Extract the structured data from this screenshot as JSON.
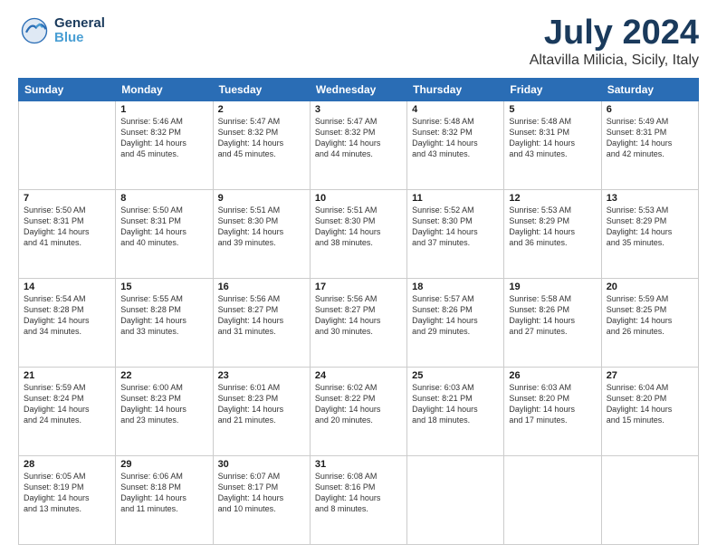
{
  "header": {
    "logo_general": "General",
    "logo_blue": "Blue",
    "month_title": "July 2024",
    "location": "Altavilla Milicia, Sicily, Italy"
  },
  "calendar": {
    "days_of_week": [
      "Sunday",
      "Monday",
      "Tuesday",
      "Wednesday",
      "Thursday",
      "Friday",
      "Saturday"
    ],
    "weeks": [
      [
        {
          "day": "",
          "info": ""
        },
        {
          "day": "1",
          "info": "Sunrise: 5:46 AM\nSunset: 8:32 PM\nDaylight: 14 hours\nand 45 minutes."
        },
        {
          "day": "2",
          "info": "Sunrise: 5:47 AM\nSunset: 8:32 PM\nDaylight: 14 hours\nand 45 minutes."
        },
        {
          "day": "3",
          "info": "Sunrise: 5:47 AM\nSunset: 8:32 PM\nDaylight: 14 hours\nand 44 minutes."
        },
        {
          "day": "4",
          "info": "Sunrise: 5:48 AM\nSunset: 8:32 PM\nDaylight: 14 hours\nand 43 minutes."
        },
        {
          "day": "5",
          "info": "Sunrise: 5:48 AM\nSunset: 8:31 PM\nDaylight: 14 hours\nand 43 minutes."
        },
        {
          "day": "6",
          "info": "Sunrise: 5:49 AM\nSunset: 8:31 PM\nDaylight: 14 hours\nand 42 minutes."
        }
      ],
      [
        {
          "day": "7",
          "info": "Sunrise: 5:50 AM\nSunset: 8:31 PM\nDaylight: 14 hours\nand 41 minutes."
        },
        {
          "day": "8",
          "info": "Sunrise: 5:50 AM\nSunset: 8:31 PM\nDaylight: 14 hours\nand 40 minutes."
        },
        {
          "day": "9",
          "info": "Sunrise: 5:51 AM\nSunset: 8:30 PM\nDaylight: 14 hours\nand 39 minutes."
        },
        {
          "day": "10",
          "info": "Sunrise: 5:51 AM\nSunset: 8:30 PM\nDaylight: 14 hours\nand 38 minutes."
        },
        {
          "day": "11",
          "info": "Sunrise: 5:52 AM\nSunset: 8:30 PM\nDaylight: 14 hours\nand 37 minutes."
        },
        {
          "day": "12",
          "info": "Sunrise: 5:53 AM\nSunset: 8:29 PM\nDaylight: 14 hours\nand 36 minutes."
        },
        {
          "day": "13",
          "info": "Sunrise: 5:53 AM\nSunset: 8:29 PM\nDaylight: 14 hours\nand 35 minutes."
        }
      ],
      [
        {
          "day": "14",
          "info": "Sunrise: 5:54 AM\nSunset: 8:28 PM\nDaylight: 14 hours\nand 34 minutes."
        },
        {
          "day": "15",
          "info": "Sunrise: 5:55 AM\nSunset: 8:28 PM\nDaylight: 14 hours\nand 33 minutes."
        },
        {
          "day": "16",
          "info": "Sunrise: 5:56 AM\nSunset: 8:27 PM\nDaylight: 14 hours\nand 31 minutes."
        },
        {
          "day": "17",
          "info": "Sunrise: 5:56 AM\nSunset: 8:27 PM\nDaylight: 14 hours\nand 30 minutes."
        },
        {
          "day": "18",
          "info": "Sunrise: 5:57 AM\nSunset: 8:26 PM\nDaylight: 14 hours\nand 29 minutes."
        },
        {
          "day": "19",
          "info": "Sunrise: 5:58 AM\nSunset: 8:26 PM\nDaylight: 14 hours\nand 27 minutes."
        },
        {
          "day": "20",
          "info": "Sunrise: 5:59 AM\nSunset: 8:25 PM\nDaylight: 14 hours\nand 26 minutes."
        }
      ],
      [
        {
          "day": "21",
          "info": "Sunrise: 5:59 AM\nSunset: 8:24 PM\nDaylight: 14 hours\nand 24 minutes."
        },
        {
          "day": "22",
          "info": "Sunrise: 6:00 AM\nSunset: 8:23 PM\nDaylight: 14 hours\nand 23 minutes."
        },
        {
          "day": "23",
          "info": "Sunrise: 6:01 AM\nSunset: 8:23 PM\nDaylight: 14 hours\nand 21 minutes."
        },
        {
          "day": "24",
          "info": "Sunrise: 6:02 AM\nSunset: 8:22 PM\nDaylight: 14 hours\nand 20 minutes."
        },
        {
          "day": "25",
          "info": "Sunrise: 6:03 AM\nSunset: 8:21 PM\nDaylight: 14 hours\nand 18 minutes."
        },
        {
          "day": "26",
          "info": "Sunrise: 6:03 AM\nSunset: 8:20 PM\nDaylight: 14 hours\nand 17 minutes."
        },
        {
          "day": "27",
          "info": "Sunrise: 6:04 AM\nSunset: 8:20 PM\nDaylight: 14 hours\nand 15 minutes."
        }
      ],
      [
        {
          "day": "28",
          "info": "Sunrise: 6:05 AM\nSunset: 8:19 PM\nDaylight: 14 hours\nand 13 minutes."
        },
        {
          "day": "29",
          "info": "Sunrise: 6:06 AM\nSunset: 8:18 PM\nDaylight: 14 hours\nand 11 minutes."
        },
        {
          "day": "30",
          "info": "Sunrise: 6:07 AM\nSunset: 8:17 PM\nDaylight: 14 hours\nand 10 minutes."
        },
        {
          "day": "31",
          "info": "Sunrise: 6:08 AM\nSunset: 8:16 PM\nDaylight: 14 hours\nand 8 minutes."
        },
        {
          "day": "",
          "info": ""
        },
        {
          "day": "",
          "info": ""
        },
        {
          "day": "",
          "info": ""
        }
      ]
    ]
  }
}
